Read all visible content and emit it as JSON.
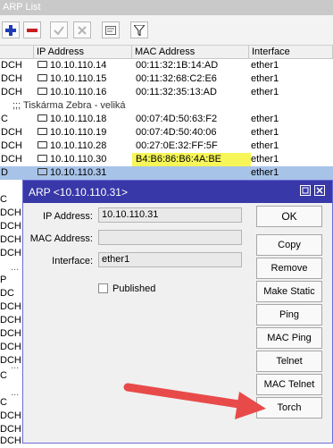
{
  "window": {
    "title": "ARP List"
  },
  "toolbar": {
    "add_icon": "plus-icon",
    "remove_icon": "minus-icon",
    "enable_icon": "check-icon",
    "disable_icon": "x-icon",
    "comment_icon": "comment-icon",
    "filter_icon": "filter-icon"
  },
  "table": {
    "columns": [
      "IP Address",
      "MAC Address",
      "Interface"
    ],
    "rows": [
      {
        "flag": "DCH",
        "ip": "10.10.110.14",
        "mac": "00:11:32:1B:14:AD",
        "iface": "ether1"
      },
      {
        "flag": "DCH",
        "ip": "10.10.110.15",
        "mac": "00:11:32:68:C2:E6",
        "iface": "ether1"
      },
      {
        "flag": "DCH",
        "ip": "10.10.110.16",
        "mac": "00:11:32:35:13:AD",
        "iface": "ether1"
      },
      {
        "comment": ";;; Tiskárma Zebra - veliká"
      },
      {
        "flag": "C",
        "ip": "10.10.110.18",
        "mac": "00:07:4D:50:63:F2",
        "iface": "ether1"
      },
      {
        "flag": "DCH",
        "ip": "10.10.110.19",
        "mac": "00:07:4D:50:40:06",
        "iface": "ether1"
      },
      {
        "flag": "DCH",
        "ip": "10.10.110.28",
        "mac": "00:27:0E:32:FF:5F",
        "iface": "ether1"
      },
      {
        "flag": "DCH",
        "ip": "10.10.110.30",
        "mac": "B4:B6:86:B6:4A:BE",
        "iface": "ether1"
      },
      {
        "flag": "D",
        "ip": "10.10.110.31",
        "mac": "",
        "iface": "ether1",
        "selected": true
      }
    ],
    "left_strip": [
      "C",
      "DCH",
      "DCH",
      "DCH",
      "DCH",
      "...",
      "P",
      "DC",
      "DCH",
      "DCH",
      "DCH",
      "DCH",
      "DCH",
      "...",
      "C",
      "...",
      "C",
      "DCH",
      "DCH",
      "DCH"
    ]
  },
  "dialog": {
    "title": "ARP <10.10.110.31>",
    "ip_label": "IP Address:",
    "ip_value": "10.10.110.31",
    "mac_label": "MAC Address:",
    "mac_value": "",
    "iface_label": "Interface:",
    "iface_value": "ether1",
    "published_label": "Published",
    "buttons": {
      "ok": "OK",
      "copy": "Copy",
      "remove": "Remove",
      "make_static": "Make Static",
      "ping": "Ping",
      "mac_ping": "MAC Ping",
      "telnet": "Telnet",
      "mac_telnet": "MAC Telnet",
      "torch": "Torch"
    }
  },
  "colors": {
    "selected_row": "#a8c3e8",
    "dialog_title": "#3838a8",
    "highlight": "#f5f43c",
    "arrow": "#e84a4a"
  }
}
